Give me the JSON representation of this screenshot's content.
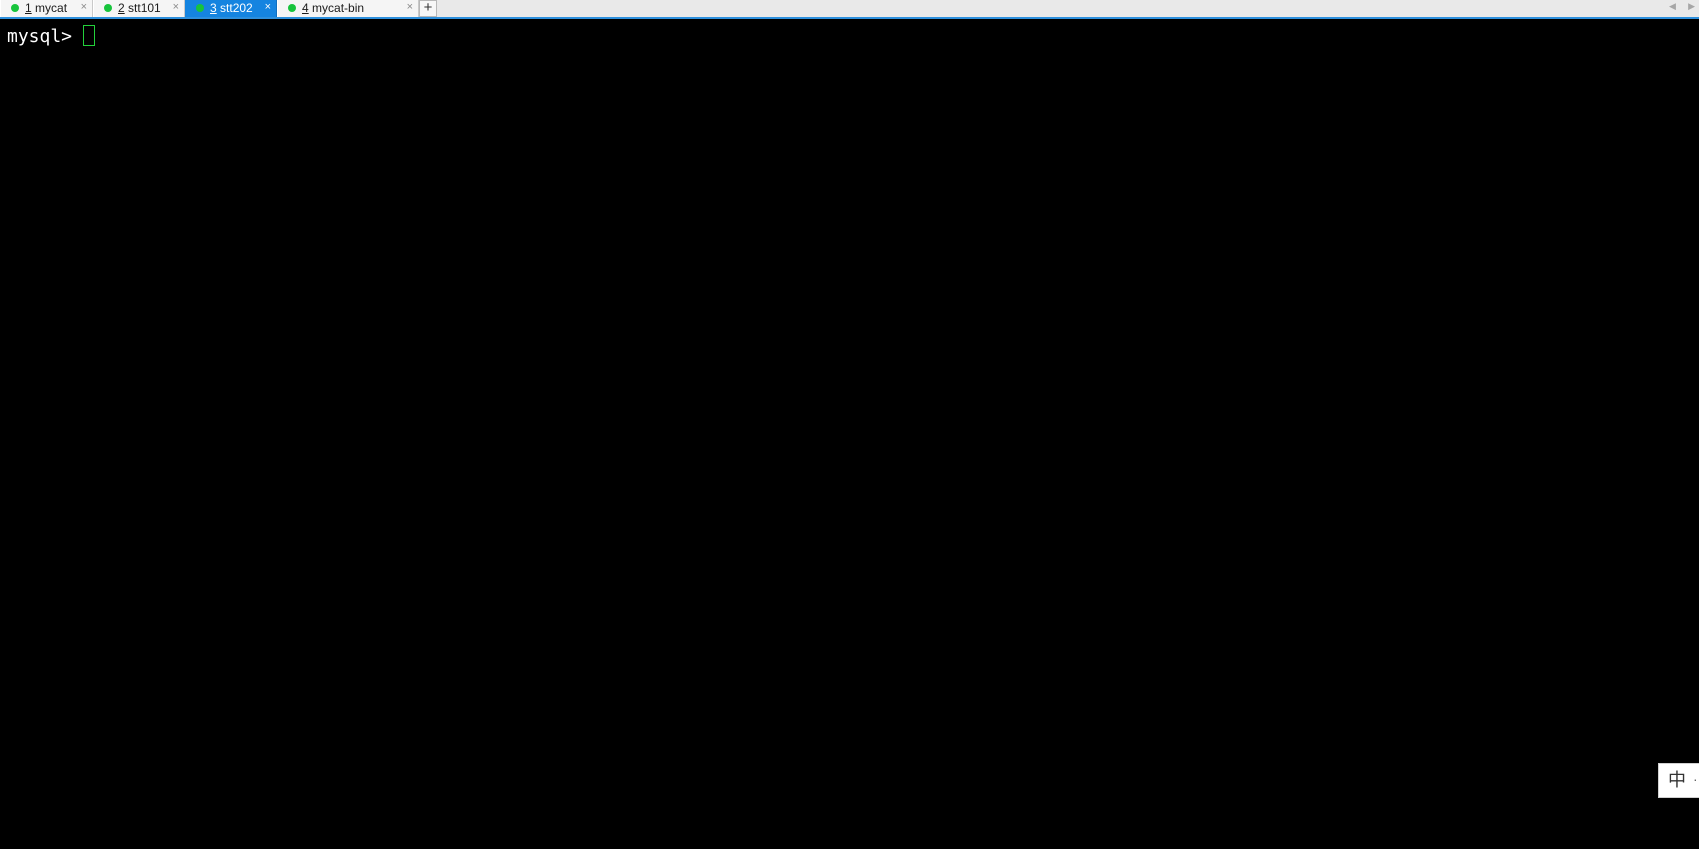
{
  "tabs": [
    {
      "number": "1",
      "title": "mycat",
      "close": "×",
      "active": false
    },
    {
      "number": "2",
      "title": "stt101",
      "close": "×",
      "active": false
    },
    {
      "number": "3",
      "title": "stt202",
      "close": "×",
      "active": true
    },
    {
      "number": "4",
      "title": "mycat-bin",
      "close": "×",
      "active": false
    }
  ],
  "add_tab_label": "+",
  "scroll": {
    "left": "◀",
    "right": "▶"
  },
  "terminal": {
    "prompt": "mysql> "
  },
  "ime": {
    "mode": "中",
    "extra": "·"
  },
  "colors": {
    "tab_active": "#1584e0",
    "status_dot": "#17c43c",
    "cursor": "#23d13b",
    "terminal_bg": "#000000"
  }
}
